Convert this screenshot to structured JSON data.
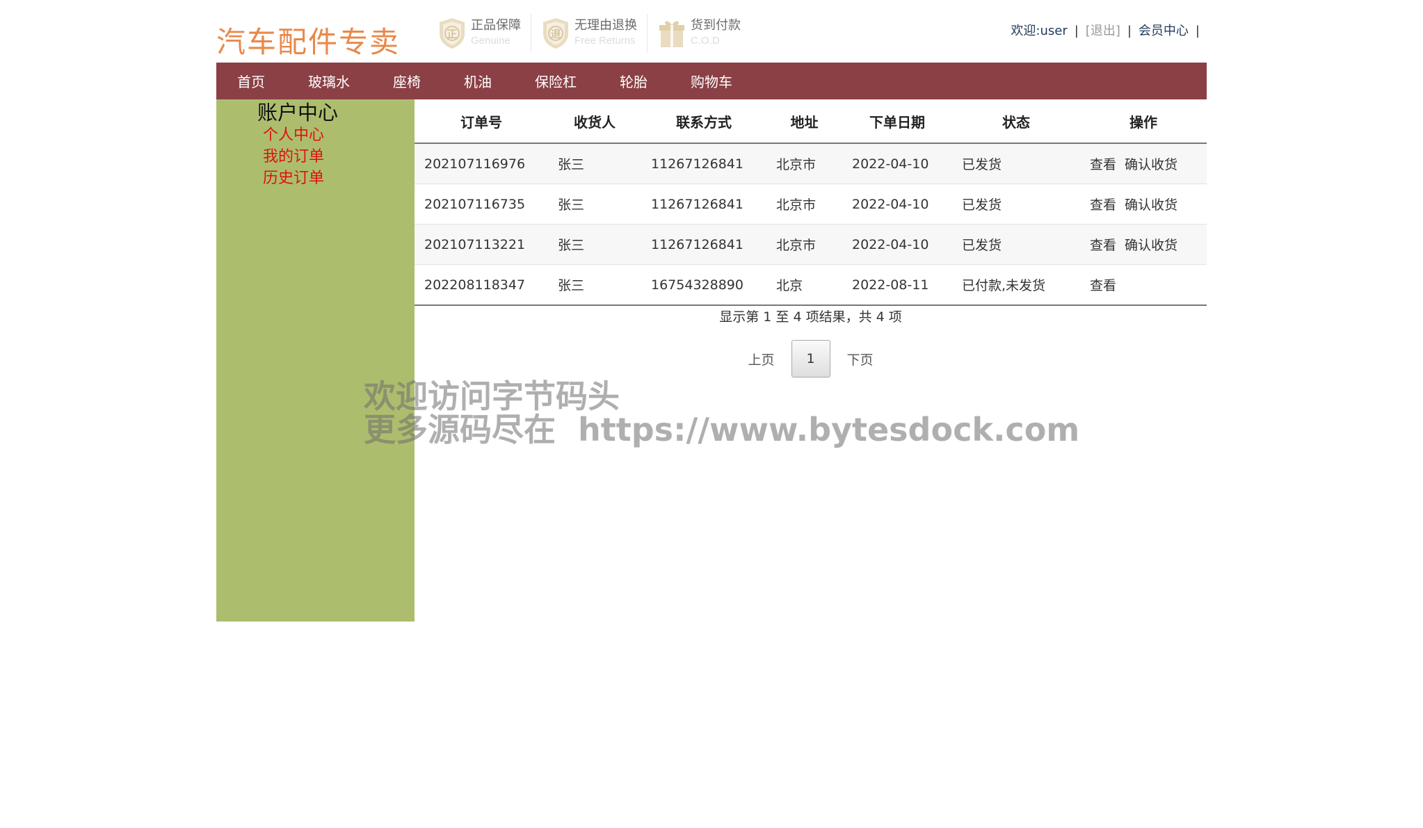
{
  "header": {
    "logo": "汽车配件专卖",
    "badges": [
      {
        "title": "正品保障",
        "subtitle": "Genuine",
        "icon": "shield-zheng-icon",
        "glyph": "正"
      },
      {
        "title": "无理由退换",
        "subtitle": "Free Returns",
        "icon": "shield-tui-icon",
        "glyph": "退"
      },
      {
        "title": "货到付款",
        "subtitle": "C.O.D",
        "icon": "gift-box-icon",
        "glyph": ""
      }
    ],
    "user": {
      "welcome": "欢迎:user",
      "sep1": "|",
      "logout": "[退出]",
      "sep2": "|",
      "member_center": "会员中心",
      "sep3": "|"
    }
  },
  "nav": {
    "items": [
      "首页",
      "玻璃水",
      "座椅",
      "机油",
      "保险杠",
      "轮胎",
      "购物车"
    ]
  },
  "sidebar": {
    "title": "账户中心",
    "links": [
      "个人中心",
      "我的订单",
      "历史订单"
    ]
  },
  "orders": {
    "columns": [
      "订单号",
      "收货人",
      "联系方式",
      "地址",
      "下单日期",
      "状态",
      "操作"
    ],
    "rows": [
      {
        "id": "202107116976",
        "receiver": "张三",
        "phone": "11267126841",
        "address": "北京市",
        "date": "2022-04-10",
        "status": "已发货",
        "view": "查看",
        "confirm": "确认收货"
      },
      {
        "id": "202107116735",
        "receiver": "张三",
        "phone": "11267126841",
        "address": "北京市",
        "date": "2022-04-10",
        "status": "已发货",
        "view": "查看",
        "confirm": "确认收货"
      },
      {
        "id": "202107113221",
        "receiver": "张三",
        "phone": "11267126841",
        "address": "北京市",
        "date": "2022-04-10",
        "status": "已发货",
        "view": "查看",
        "confirm": "确认收货"
      },
      {
        "id": "202208118347",
        "receiver": "张三",
        "phone": "16754328890",
        "address": "北京",
        "date": "2022-08-11",
        "status": "已付款,未发货",
        "view": "查看",
        "confirm": ""
      }
    ],
    "summary": "显示第 1 至 4 项结果，共 4 项",
    "pager": {
      "prev": "上页",
      "current": "1",
      "next": "下页"
    }
  },
  "watermark": {
    "line1": "欢迎访问字节码头",
    "line2": "更多源码尽在  https://www.bytesdock.com"
  },
  "colors": {
    "nav_bg": "#8b4045",
    "sidebar_bg": "#adbd6e",
    "logo": "#e8894a",
    "sidebar_link": "#e01010"
  }
}
